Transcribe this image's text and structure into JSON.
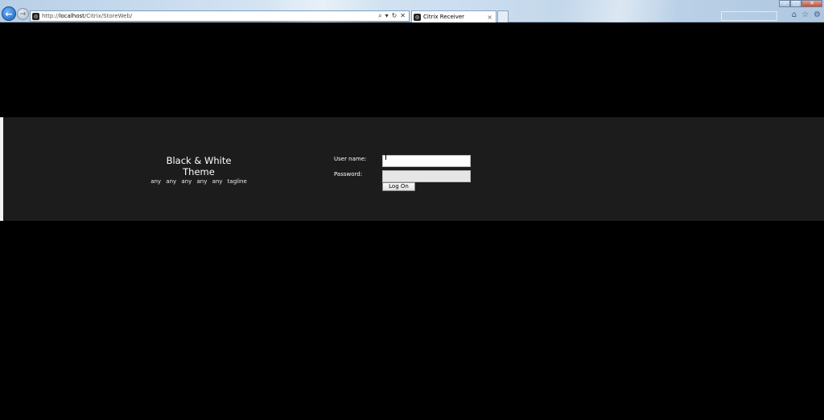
{
  "browser": {
    "address": {
      "prefix": "http://",
      "host": "localhost",
      "path": "/Citrix/StoreWeb/"
    },
    "address_tools": [
      "⌕",
      "▾",
      "↻",
      "✕"
    ],
    "tab": {
      "title": "Citrix Receiver",
      "close": "×"
    },
    "window_controls": [
      "–",
      "□",
      "✕"
    ],
    "command_icons": [
      "⌂",
      "☆",
      "⚙"
    ]
  },
  "brand": {
    "title": "Black & White Theme",
    "tagline": "any any any any any tagline"
  },
  "login": {
    "username_label": "User name:",
    "username_value": "",
    "password_label": "Password:",
    "password_value": "",
    "logon_label": "Log On"
  }
}
